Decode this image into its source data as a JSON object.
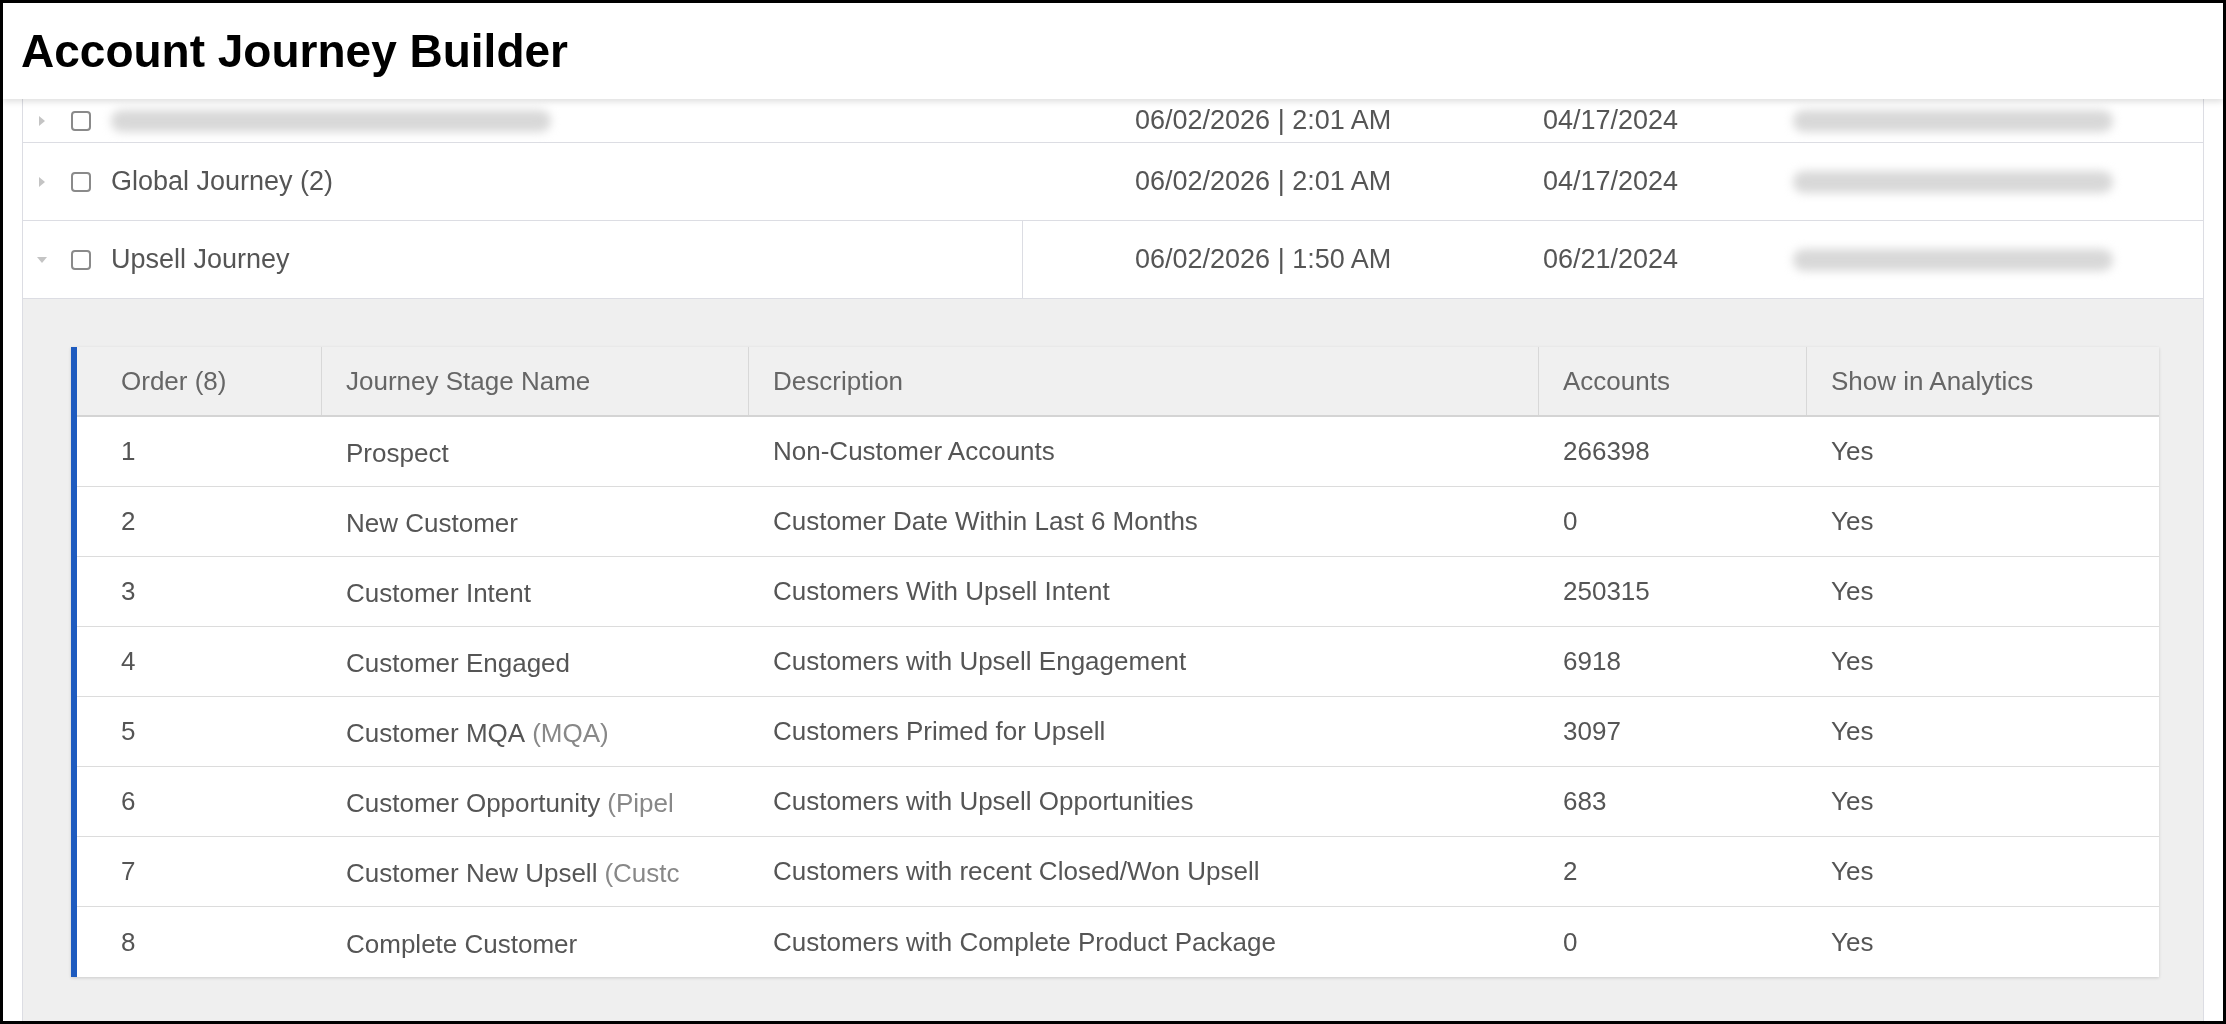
{
  "title": "Account Journey Builder",
  "journeys": [
    {
      "name_redacted": true,
      "expanded": false,
      "checked": false,
      "modified": "06/02/2026 | 2:01 AM",
      "created": "04/17/2024",
      "owner_redacted": true
    },
    {
      "name": "Global Journey (2)",
      "expanded": false,
      "checked": false,
      "modified": "06/02/2026 | 2:01 AM",
      "created": "04/17/2024",
      "owner_redacted": true
    },
    {
      "name": "Upsell Journey",
      "expanded": true,
      "checked": false,
      "modified": "06/02/2026 | 1:50 AM",
      "created": "06/21/2024",
      "owner_redacted": true
    }
  ],
  "stages": {
    "columns": [
      "Order (8)",
      "Journey Stage Name",
      "Description",
      "Accounts",
      "Show in Analytics"
    ],
    "rows": [
      {
        "order": "1",
        "name": "Prospect",
        "description": "Non-Customer Accounts",
        "accounts": "266398",
        "show": "Yes"
      },
      {
        "order": "2",
        "name": "New Customer",
        "description": "Customer Date Within Last 6 Months",
        "accounts": "0",
        "show": "Yes"
      },
      {
        "order": "3",
        "name": "Customer Intent",
        "description": "Customers With Upsell Intent",
        "accounts": "250315",
        "show": "Yes"
      },
      {
        "order": "4",
        "name": "Customer Engaged",
        "description": "Customers with Upsell Engagement",
        "accounts": "6918",
        "show": "Yes"
      },
      {
        "order": "5",
        "name": "Customer MQA",
        "alias": "(MQA)",
        "description": "Customers Primed for Upsell",
        "accounts": "3097",
        "show": "Yes"
      },
      {
        "order": "6",
        "name": "Customer Opportunity",
        "alias": "(Pipel",
        "description": "Customers with Upsell Opportunities",
        "accounts": "683",
        "show": "Yes"
      },
      {
        "order": "7",
        "name": "Customer New Upsell",
        "alias": "(Custc",
        "description": "Customers with recent Closed/Won Upsell",
        "accounts": "2",
        "show": "Yes"
      },
      {
        "order": "8",
        "name": "Complete Customer",
        "description": "Customers with Complete Product Package",
        "accounts": "0",
        "show": "Yes"
      }
    ]
  }
}
